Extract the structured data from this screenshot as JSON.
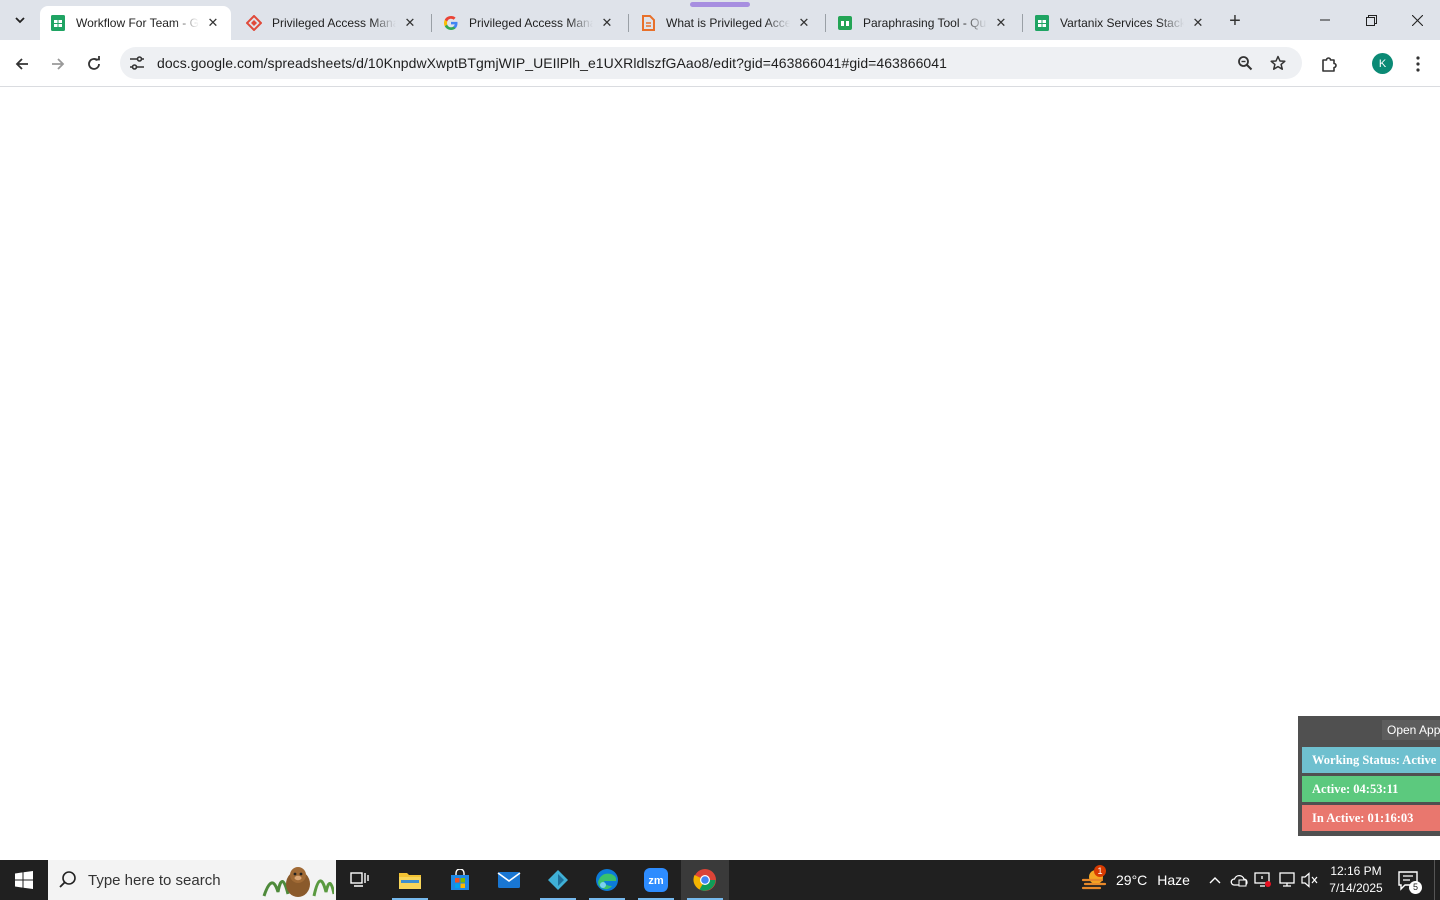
{
  "browser": {
    "tabs": [
      {
        "title": "Workflow For Team - Google Sheets",
        "favicon": "google-sheets-icon",
        "active": true
      },
      {
        "title": "Privileged Access Management",
        "favicon": "diamond-red-icon",
        "active": false
      },
      {
        "title": "Privileged Access Management",
        "favicon": "google-icon",
        "active": false
      },
      {
        "title": "What is Privileged Access",
        "favicon": "document-orange-icon",
        "active": false
      },
      {
        "title": "Paraphrasing Tool - QuillBot",
        "favicon": "quillbot-icon",
        "active": false
      },
      {
        "title": "Vartanix Services Stack",
        "favicon": "google-sheets-icon",
        "active": false
      }
    ],
    "close_glyph": "✕",
    "new_tab_glyph": "+",
    "url": "docs.google.com/spreadsheets/d/10KnpdwXwptBTgmjWIP_UEIlPlh_e1UXRldlszfGAao8/edit?gid=463866041#gid=463866041",
    "profile_initial": "K"
  },
  "tracker": {
    "open_app": "Open App",
    "working_status": "Working Status: Active",
    "active": "Active: 04:53:11",
    "inactive": "In Active: 01:16:03",
    "colors": {
      "status": "#6fc0cf",
      "active": "#5cc97e",
      "inactive": "#e9776e",
      "panel": "#505050"
    }
  },
  "taskbar": {
    "search_placeholder": "Type here to search",
    "weather_temp": "29°C",
    "weather_condition": "Haze",
    "weather_badge": "1",
    "time": "12:16 PM",
    "date": "7/14/2025",
    "notification_count": "5"
  }
}
